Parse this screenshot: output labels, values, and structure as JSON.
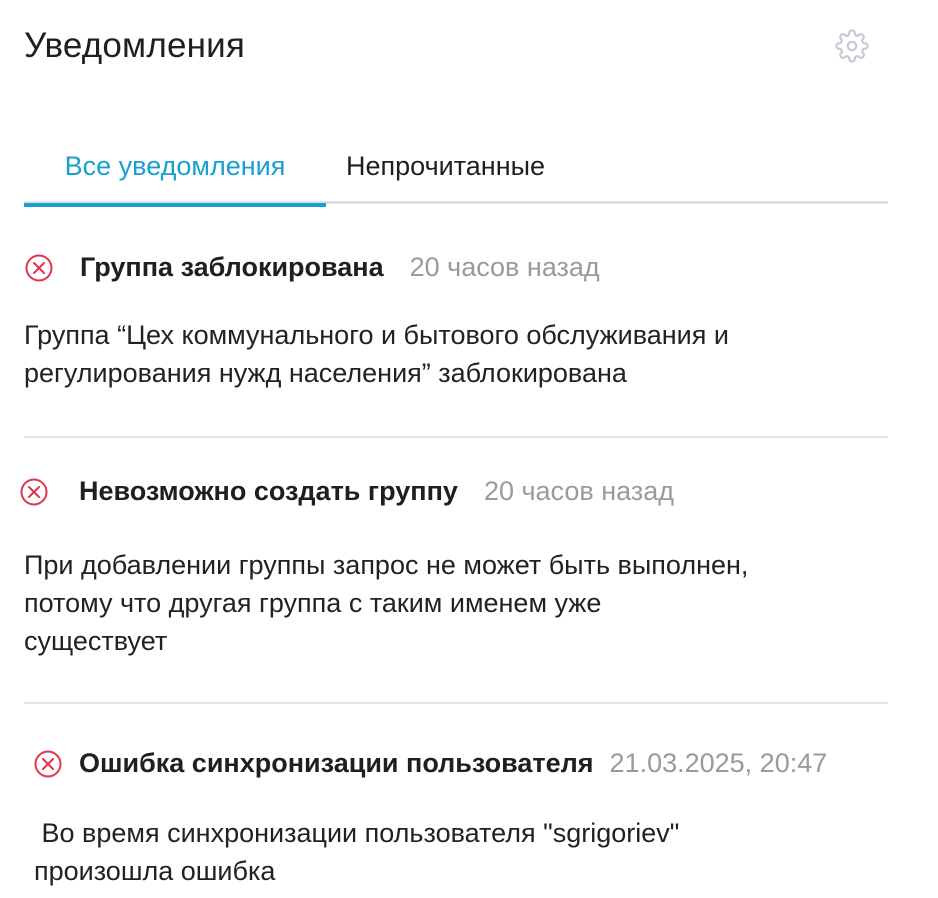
{
  "header": {
    "title": "Уведомления",
    "settings_icon": "gear-icon"
  },
  "tabs": [
    {
      "label": "Все уведомления",
      "active": true
    },
    {
      "label": "Непрочитанные",
      "active": false
    }
  ],
  "notifications": [
    {
      "icon": "error-circle-x-icon",
      "title": "Группа заблокирована",
      "time": "20 часов назад",
      "body_lines": [
        "Группа “Цех коммунального и бытового обслуживания и",
        "регулирования нужд населения” заблокирована"
      ]
    },
    {
      "icon": "error-circle-x-icon",
      "title": "Невозможно создать группу",
      "time": "20 часов назад",
      "body_lines": [
        "При добавлении группы запрос не может быть выполнен,",
        "потому что другая группа с таким именем уже",
        "существует"
      ]
    },
    {
      "icon": "error-circle-x-icon",
      "title": "Ошибка синхронизации пользователя",
      "time": "21.03.2025, 20:47",
      "body_lines": [
        " Во время синхронизации пользователя \"sgrigoriev\"",
        "произошла ошибка"
      ]
    }
  ],
  "colors": {
    "accent": "#1a9fd1",
    "error": "#e0334d",
    "muted_text": "#9a9a9a",
    "divider": "#e1e3eb",
    "icon_gray": "#c5c8d4"
  }
}
